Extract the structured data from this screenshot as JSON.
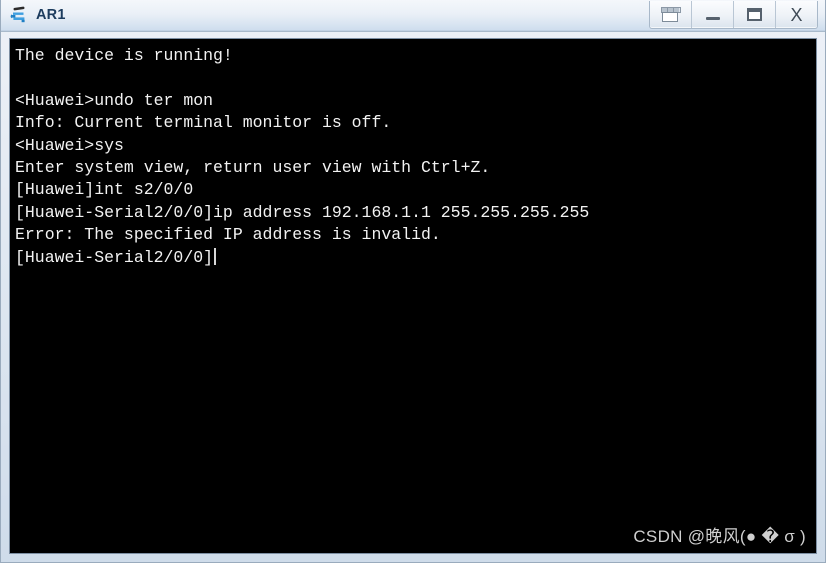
{
  "window": {
    "title": "AR1",
    "icon": "router-device-icon",
    "controls": [
      {
        "name": "restore-windows-button",
        "label": "",
        "icon": "restore-windows-icon"
      },
      {
        "name": "minimize-button",
        "label": "",
        "icon": "minimize-icon"
      },
      {
        "name": "maximize-button",
        "label": "",
        "icon": "maximize-icon"
      },
      {
        "name": "close-button",
        "label": "X",
        "icon": "close-icon"
      }
    ]
  },
  "terminal": {
    "background_color": "#000000",
    "text_color": "#f2f2f2",
    "cursor_visible": true,
    "lines": [
      "The device is running!",
      "",
      "<Huawei>undo ter mon",
      "Info: Current terminal monitor is off.",
      "<Huawei>sys",
      "Enter system view, return user view with Ctrl+Z.",
      "[Huawei]int s2/0/0",
      "[Huawei-Serial2/0/0]ip address 192.168.1.1 255.255.255.255",
      "Error: The specified IP address is invalid.",
      "[Huawei-Serial2/0/0]"
    ],
    "prompt_line_index": 9
  },
  "watermark": {
    "text": "CSDN @晚风(● � σ )"
  }
}
